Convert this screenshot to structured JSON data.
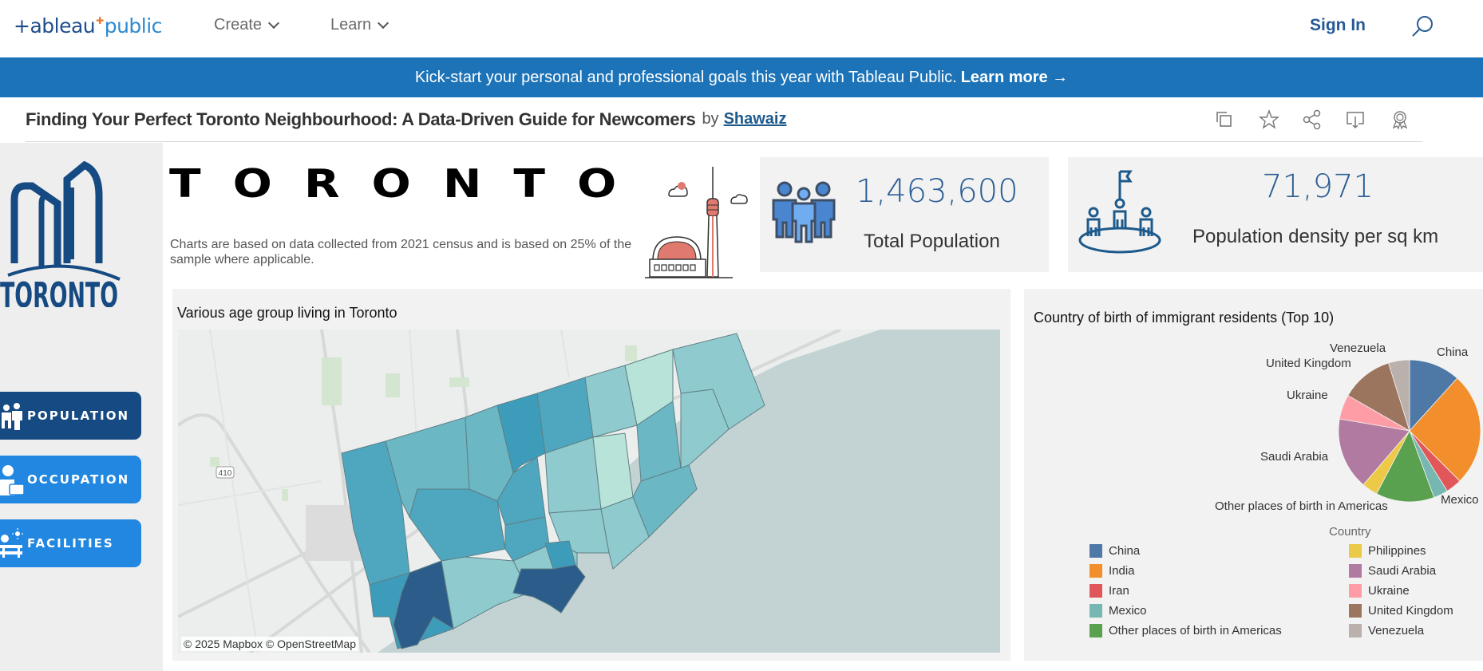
{
  "topnav": {
    "logo_left": "+ableau",
    "logo_right": "public",
    "menu": [
      {
        "label": "Create"
      },
      {
        "label": "Learn"
      }
    ],
    "sign_in": "Sign In",
    "search_icon": "search-icon"
  },
  "banner": {
    "text": "Kick-start your personal and professional goals this year with Tableau Public.",
    "link": "Learn more →"
  },
  "viz_header": {
    "title": "Finding Your Perfect Toronto Neighbourhood: A Data-Driven Guide for Newcomers",
    "by": "by",
    "author": "Shawaiz",
    "tools": [
      "copy-icon",
      "star-icon",
      "share-icon",
      "download-icon",
      "award-icon"
    ]
  },
  "sidebar": {
    "logo_text": "TORONTO",
    "buttons": [
      {
        "label": "POPULATION",
        "icon": "people-icon",
        "active": true
      },
      {
        "label": "OCCUPATION",
        "icon": "worker-icon",
        "active": false
      },
      {
        "label": "FACILITIES",
        "icon": "park-icon",
        "active": false
      }
    ]
  },
  "header": {
    "city_word": "TORONTO",
    "description": "Charts are based on data collected from 2021 census and is based on 25% of the sample where applicable."
  },
  "kpis": [
    {
      "value": "1,463,600",
      "label": "Total Population",
      "icon": "people-icon"
    },
    {
      "value": "71,971",
      "label": "Population density per sq km",
      "icon": "community-icon"
    }
  ],
  "map_panel": {
    "title": "Various age group living in Toronto",
    "highway_label": "410",
    "attribution": "© 2025 Mapbox  © OpenStreetMap",
    "colors": {
      "lightest": "#b8e3d8",
      "light": "#8fcbce",
      "mid": "#6bb7c4",
      "midDark": "#4ea7bf",
      "dark": "#3e9cbb",
      "darkest": "#2c5d8a",
      "water": "#c3d3d3",
      "land": "#eceeed"
    }
  },
  "pie_panel": {
    "title": "Country of birth of immigrant residents (Top 10)",
    "legend_title": "Country"
  },
  "chart_data": {
    "type": "pie",
    "title": "Country of birth of immigrant residents (Top 10)",
    "legend_title": "Country",
    "legend_position": "bottom",
    "slices": [
      {
        "label": "China",
        "percent": 11.7,
        "color": "#4e79a7"
      },
      {
        "label": "India",
        "percent": 25.8,
        "color": "#f28e2b"
      },
      {
        "label": "Iran",
        "percent": 3.6,
        "color": "#e15759"
      },
      {
        "label": "Mexico",
        "percent": 3.3,
        "color": "#76b7b2"
      },
      {
        "label": "Other places of birth in Americas",
        "percent": 13.3,
        "color": "#59a14f"
      },
      {
        "label": "Philippines",
        "percent": 3.6,
        "color": "#edc948"
      },
      {
        "label": "Saudi Arabia",
        "percent": 16.4,
        "color": "#b07aa1"
      },
      {
        "label": "Ukraine",
        "percent": 5.6,
        "color": "#ff9da7"
      },
      {
        "label": "United Kingdom",
        "percent": 11.9,
        "color": "#9c755f"
      },
      {
        "label": "Venezuela",
        "percent": 4.8,
        "color": "#bab0ac"
      }
    ],
    "slice_labels": [
      "China",
      "Mexico",
      "Other places of birth in Americas",
      "Saudi Arabia",
      "Ukraine",
      "United Kingdom",
      "Venezuela"
    ]
  }
}
